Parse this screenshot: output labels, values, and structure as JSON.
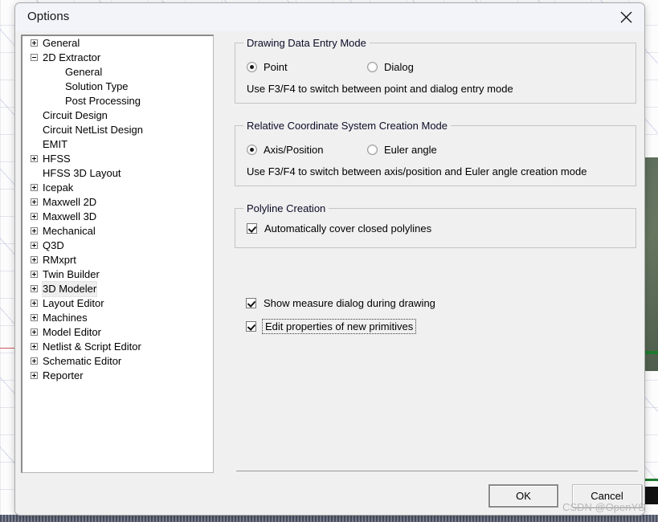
{
  "window": {
    "title": "Options",
    "close_icon": "close-icon"
  },
  "tree": {
    "items": [
      {
        "label": "General",
        "indent": 0,
        "expander": "plus"
      },
      {
        "label": "2D Extractor",
        "indent": 0,
        "expander": "minus"
      },
      {
        "label": "General",
        "indent": 1,
        "expander": "none"
      },
      {
        "label": "Solution Type",
        "indent": 1,
        "expander": "none"
      },
      {
        "label": "Post Processing",
        "indent": 1,
        "expander": "none"
      },
      {
        "label": "Circuit Design",
        "indent": 0,
        "expander": "none"
      },
      {
        "label": "Circuit NetList Design",
        "indent": 0,
        "expander": "none"
      },
      {
        "label": "EMIT",
        "indent": 0,
        "expander": "none"
      },
      {
        "label": "HFSS",
        "indent": 0,
        "expander": "plus"
      },
      {
        "label": "HFSS 3D Layout",
        "indent": 0,
        "expander": "none"
      },
      {
        "label": "Icepak",
        "indent": 0,
        "expander": "plus"
      },
      {
        "label": "Maxwell 2D",
        "indent": 0,
        "expander": "plus"
      },
      {
        "label": "Maxwell 3D",
        "indent": 0,
        "expander": "plus"
      },
      {
        "label": "Mechanical",
        "indent": 0,
        "expander": "plus"
      },
      {
        "label": "Q3D",
        "indent": 0,
        "expander": "plus"
      },
      {
        "label": "RMxprt",
        "indent": 0,
        "expander": "plus"
      },
      {
        "label": "Twin Builder",
        "indent": 0,
        "expander": "plus"
      },
      {
        "label": "3D Modeler",
        "indent": 0,
        "expander": "plus",
        "selected": true
      },
      {
        "label": "Layout Editor",
        "indent": 0,
        "expander": "plus"
      },
      {
        "label": "Machines",
        "indent": 0,
        "expander": "plus"
      },
      {
        "label": "Model Editor",
        "indent": 0,
        "expander": "plus"
      },
      {
        "label": "Netlist & Script Editor",
        "indent": 0,
        "expander": "plus"
      },
      {
        "label": "Schematic Editor",
        "indent": 0,
        "expander": "plus"
      },
      {
        "label": "Reporter",
        "indent": 0,
        "expander": "plus"
      }
    ]
  },
  "panel": {
    "drawing_data_entry_mode": {
      "title": "Drawing Data Entry Mode",
      "option_point": "Point",
      "option_dialog": "Dialog",
      "point_selected": true,
      "hint": "Use F3/F4 to switch between point and dialog entry mode"
    },
    "relative_coordinate_system": {
      "title": "Relative Coordinate System Creation Mode",
      "option_axis_position": "Axis/Position",
      "option_euler_angle": "Euler angle",
      "axis_position_selected": true,
      "hint": "Use F3/F4 to switch between axis/position and Euler angle creation mode"
    },
    "polyline_creation": {
      "title": "Polyline Creation",
      "auto_cover_label": "Automatically cover closed polylines",
      "auto_cover_checked": true
    },
    "standalone_checkboxes": [
      {
        "label": "Show measure dialog during drawing",
        "checked": true,
        "focused": false
      },
      {
        "label": "Edit properties of new primitives",
        "checked": true,
        "focused": true
      }
    ]
  },
  "footer": {
    "ok_label": "OK",
    "cancel_label": "Cancel"
  },
  "watermark": {
    "text": "CSDN @OpenYS"
  },
  "colors": {
    "dialog_background": "#f0f0f0",
    "titlebar_background": "#f2f4fa",
    "tree_background": "#ffffff",
    "groupbox_border": "#c4c4c4",
    "text": "#000000",
    "watermark": "#b9b9b9"
  }
}
